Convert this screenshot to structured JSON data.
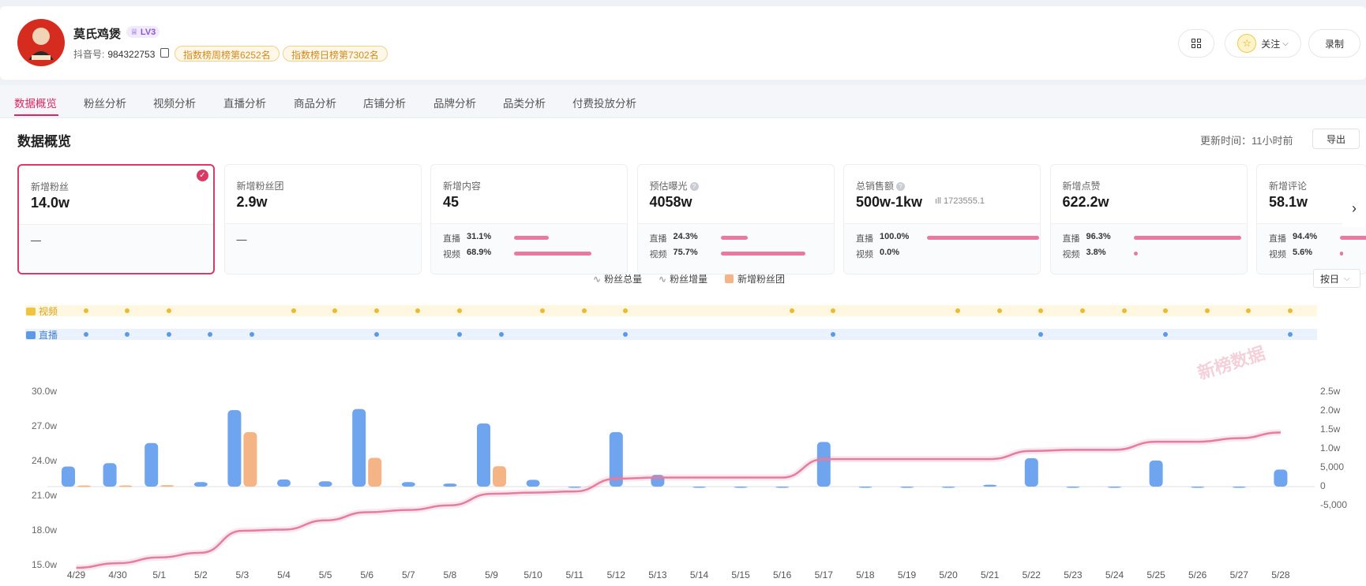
{
  "account": {
    "name": "莫氏鸡煲",
    "level": "LV3",
    "douyin_id_label": "抖音号:",
    "douyin_id": "984322753",
    "rank_week": "指数榜周榜第6252名",
    "rank_day": "指数榜日榜第7302名",
    "follow_label": "关注",
    "record_label": "录制"
  },
  "tabs": [
    "数据概览",
    "粉丝分析",
    "视频分析",
    "直播分析",
    "商品分析",
    "店铺分析",
    "品牌分析",
    "品类分析",
    "付费投放分析"
  ],
  "section": {
    "title": "数据概览",
    "update_time": "更新时间：11小时前",
    "export_label": "导出"
  },
  "cards": [
    {
      "label": "新增粉丝",
      "value": "14.0w",
      "dash": "—",
      "selected": true
    },
    {
      "label": "新增粉丝团",
      "value": "2.9w",
      "dash": "—"
    },
    {
      "label": "新增内容",
      "value": "45",
      "breakdown": [
        {
          "name": "直播",
          "pct": "31.1%",
          "frac": 0.311
        },
        {
          "name": "视频",
          "pct": "68.9%",
          "frac": 0.689
        }
      ]
    },
    {
      "label": "预估曝光",
      "value": "4058w",
      "info": true,
      "breakdown": [
        {
          "name": "直播",
          "pct": "24.3%",
          "frac": 0.243
        },
        {
          "name": "视频",
          "pct": "75.7%",
          "frac": 0.757
        }
      ]
    },
    {
      "label": "总销售额",
      "value": "500w-1kw",
      "info": true,
      "extra": "1723555.1",
      "breakdown": [
        {
          "name": "直播",
          "pct": "100.0%",
          "frac": 1.0
        },
        {
          "name": "视频",
          "pct": "0.0%",
          "frac": 0.0
        }
      ]
    },
    {
      "label": "新增点赞",
      "value": "622.2w",
      "breakdown": [
        {
          "name": "直播",
          "pct": "96.3%",
          "frac": 0.963
        },
        {
          "name": "视频",
          "pct": "3.8%",
          "frac": 0.038
        }
      ]
    },
    {
      "label": "新增评论",
      "value": "58.1w",
      "breakdown": [
        {
          "name": "直播",
          "pct": "94.4%",
          "frac": 0.944
        },
        {
          "name": "视频",
          "pct": "5.6%",
          "frac": 0.056
        }
      ]
    }
  ],
  "chart_controls": {
    "granularity": "按日"
  },
  "lanes": {
    "video_label": "视频",
    "live_label": "直播",
    "video_days": [
      0,
      1,
      2,
      5,
      6,
      7,
      8,
      9,
      11,
      12,
      13,
      17,
      18,
      21,
      22,
      23,
      24,
      25,
      26,
      27,
      28,
      29
    ],
    "live_days": [
      0,
      1,
      2,
      3,
      4,
      7,
      9,
      10,
      13,
      18,
      23,
      26,
      29
    ]
  },
  "watermark": "新榜数据",
  "colors": {
    "accent": "#e0245e",
    "bar_fans": "#6fa4ee",
    "bar_fangroup": "#f5b486",
    "line_total": "#e57d9e",
    "video_dot": "#e9bb35",
    "live_dot": "#5c9ae8"
  },
  "chart_data": {
    "type": "bar",
    "categories": [
      "4/29",
      "4/30",
      "5/1",
      "5/2",
      "5/3",
      "5/4",
      "5/5",
      "5/6",
      "5/7",
      "5/8",
      "5/9",
      "5/10",
      "5/11",
      "5/12",
      "5/13",
      "5/14",
      "5/15",
      "5/16",
      "5/17",
      "5/18",
      "5/19",
      "5/20",
      "5/21",
      "5/22",
      "5/23",
      "5/24",
      "5/25",
      "5/26",
      "5/27",
      "5/28"
    ],
    "legend": [
      "粉丝总量",
      "粉丝增量",
      "新增粉丝团"
    ],
    "left_axis": {
      "ticks": [
        "15.0w",
        "18.0w",
        "21.0w",
        "24.0w",
        "27.0w",
        "30.0w"
      ],
      "ylim": [
        15.0,
        30.0
      ],
      "unit": "w"
    },
    "right_axis": {
      "ticks": [
        "-5,000",
        "0",
        "5,000",
        "1.0w",
        "1.5w",
        "2.0w",
        "2.5w"
      ],
      "ylim": [
        -5000,
        25000
      ]
    },
    "series": [
      {
        "name": "粉丝总量",
        "kind": "line",
        "axis": "left",
        "values": [
          14.8,
          15.2,
          15.7,
          16.1,
          18.0,
          18.1,
          18.9,
          19.6,
          19.8,
          20.2,
          21.2,
          21.3,
          21.4,
          22.5,
          22.6,
          22.6,
          22.6,
          22.6,
          24.2,
          24.2,
          24.2,
          24.2,
          24.2,
          24.9,
          25.0,
          25.0,
          25.7,
          25.7,
          26.0,
          26.5
        ]
      },
      {
        "name": "粉丝增量",
        "kind": "bar",
        "axis": "right",
        "values": [
          5300,
          6200,
          11500,
          1200,
          20200,
          1900,
          1400,
          20500,
          1200,
          800,
          16700,
          1800,
          0,
          14400,
          3100,
          0,
          0,
          0,
          11800,
          -300,
          -300,
          -200,
          500,
          7500,
          0,
          0,
          6900,
          0,
          0,
          4500
        ]
      },
      {
        "name": "新增粉丝团",
        "kind": "bar",
        "axis": "right",
        "values": [
          300,
          300,
          400,
          0,
          14400,
          0,
          0,
          7600,
          0,
          0,
          5400,
          0,
          0,
          0,
          0,
          0,
          0,
          0,
          0,
          0,
          0,
          0,
          0,
          0,
          0,
          0,
          0,
          0,
          0,
          0
        ]
      }
    ]
  }
}
